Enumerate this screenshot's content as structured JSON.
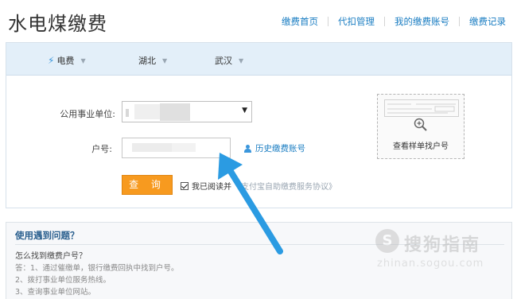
{
  "header": {
    "title": "水电煤缴费",
    "nav": [
      "缴费首页",
      "代扣管理",
      "我的缴费账号",
      "缴费记录"
    ]
  },
  "filters": {
    "type": "电费",
    "province": "湖北",
    "city": "武汉"
  },
  "form": {
    "unit_label": "公用事业单位:",
    "account_label": "户号:",
    "history_link": "历史缴费账号",
    "query_button": "查 询",
    "agree_text": "我已阅读并",
    "agree_protocol": "《支付宝自助缴费服务协议》",
    "agree_checked": true
  },
  "sample": {
    "label": "查看样单找户号"
  },
  "faq": {
    "title": "使用遇到问题？",
    "question": "怎么找到缴费户号？",
    "answers": [
      "答：1、通过催缴单，银行缴费回执中找到户号。",
      "2、拨打事业单位服务热线。",
      "3、查询事业单位网站。"
    ]
  },
  "watermark": {
    "symbol": "S",
    "brand": "搜狗指南",
    "url": "zhinan.sogou.com"
  },
  "colors": {
    "link": "#1a7dc2",
    "button": "#f79a1f",
    "header_bg": "#e3eff9",
    "arrow": "#2b9be2"
  }
}
